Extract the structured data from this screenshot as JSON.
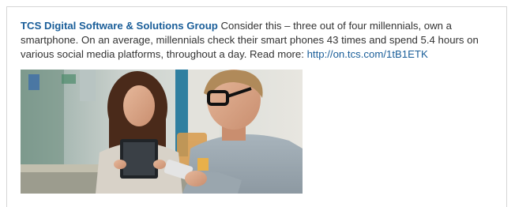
{
  "post": {
    "author": "TCS Digital Software & Solutions Group",
    "body": " Consider this – three out of four millennials, own a smartphone. On an average, millennials check their smart phones 43 times and spend 5.4 hours on various social media platforms, throughout a day. Read more: ",
    "link_text": "http://on.tcs.com/1tB1ETK"
  },
  "image": {
    "description_icon": "photo-of-woman-with-tablet-and-man-with-smartphone"
  },
  "colors": {
    "link_blue": "#1a5e99",
    "body_text": "#333333",
    "border": "#d6d6d6"
  }
}
